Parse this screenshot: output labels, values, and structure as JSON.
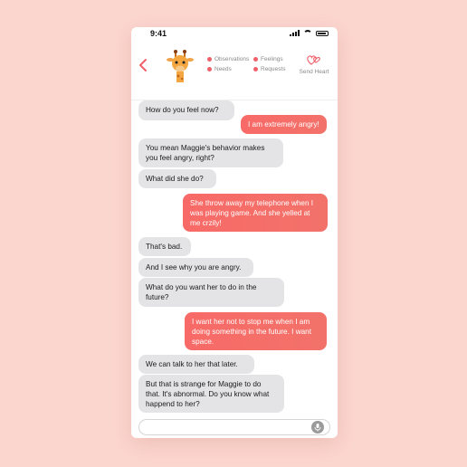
{
  "status_bar": {
    "time": "9:41"
  },
  "header": {
    "legend": [
      {
        "label": "Observations"
      },
      {
        "label": "Feelings"
      },
      {
        "label": "Needs"
      },
      {
        "label": "Requests"
      }
    ],
    "send_heart_label": "Send Heart"
  },
  "colors": {
    "accent": "#f0606a",
    "outgoing_bubble": "#f86a67",
    "incoming_bubble": "#e4e4e6",
    "background": "#fbd6cf"
  },
  "messages": [
    {
      "side": "incoming",
      "text": "How do you feel now?"
    },
    {
      "side": "outgoing",
      "text": "I am extremely angry!"
    },
    {
      "side": "incoming",
      "text": "You mean Maggie's behavior makes you feel angry, right?"
    },
    {
      "side": "incoming",
      "text": "What did she do?"
    },
    {
      "side": "outgoing",
      "text": "She throw away my telephone when I was playing game. And she yelled at me crzily!"
    },
    {
      "side": "incoming",
      "text": "That's bad."
    },
    {
      "side": "incoming",
      "text": "And I see why you are angry."
    },
    {
      "side": "incoming",
      "text": "What do you want her to do in the future?"
    },
    {
      "side": "outgoing",
      "text": "I want her not to stop me when I am doing something in the future. I want space."
    },
    {
      "side": "incoming",
      "text": "We can talk to her that later."
    },
    {
      "side": "incoming",
      "text": "But that is strange for Maggie to do that. It's abnormal. Do you know what happend to her?"
    }
  ],
  "composer": {
    "value": "",
    "icon": "mic-icon"
  }
}
